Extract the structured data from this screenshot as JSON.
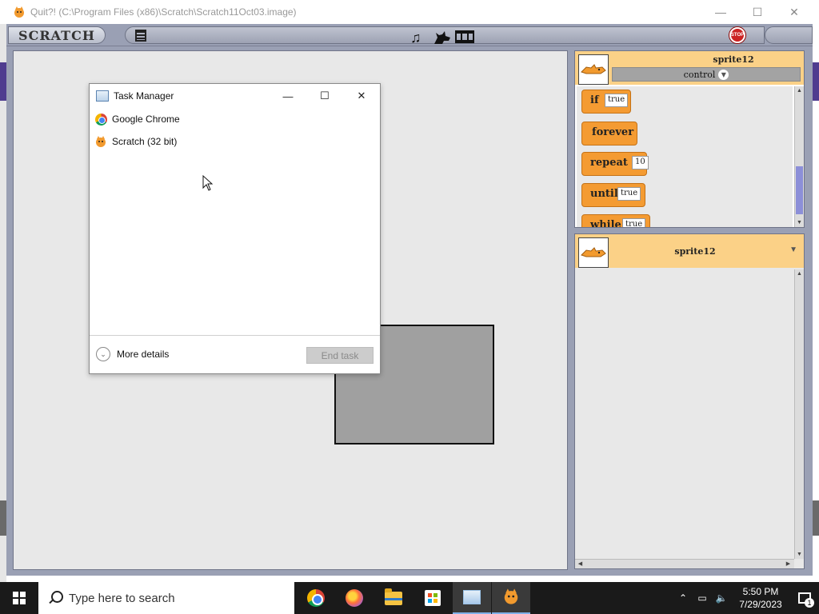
{
  "window": {
    "title": "Quit?! (C:\\Program Files (x86)\\Scratch\\Scratch11Oct03.image)",
    "minimize": "—",
    "maximize": "☐",
    "close": "✕"
  },
  "scratch": {
    "logo": "SCRATCH",
    "stop_label": "STOP",
    "toolbar_icons": [
      "file-menu-icon",
      "music-note-icon",
      "cat-icon",
      "film-icon"
    ]
  },
  "palette": {
    "sprite_name": "sprite12",
    "category": "control",
    "blocks": [
      {
        "label": "if",
        "slot": "true"
      },
      {
        "label": "forever",
        "slot": ""
      },
      {
        "label": "repeat",
        "slot": "10"
      },
      {
        "label": "until",
        "slot": "true"
      },
      {
        "label": "while",
        "slot": "true"
      }
    ]
  },
  "sprite_pane": {
    "sprite_name": "sprite12"
  },
  "task_manager": {
    "title": "Task Manager",
    "processes": [
      {
        "name": "Google Chrome",
        "icon": "chrome-icon"
      },
      {
        "name": "Scratch (32 bit)",
        "icon": "scratch-cat-icon"
      }
    ],
    "more_details": "More details",
    "end_task": "End task"
  },
  "taskbar": {
    "search_placeholder": "Type here to search",
    "apps": [
      "chrome-icon",
      "firefox-icon",
      "file-explorer-icon",
      "store-icon",
      "task-manager-icon",
      "scratch-icon"
    ],
    "time": "5:50 PM",
    "date": "7/29/2023",
    "notification_count": "1"
  }
}
